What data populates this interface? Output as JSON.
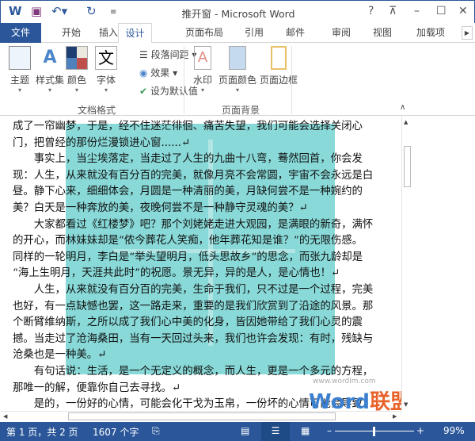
{
  "title_bar": {
    "title": "推开窗 - Microsoft Word",
    "help": "?",
    "icons": [
      "word-icon",
      "save-icon",
      "undo-icon",
      "redo-icon",
      "customize-icon"
    ]
  },
  "tabs": [
    "文件",
    "开始",
    "插入",
    "设计",
    "页面布局",
    "引用",
    "邮件",
    "审阅",
    "视图",
    "加载项"
  ],
  "ribbon": {
    "doc_format": {
      "label": "文档格式",
      "buttons": [
        "主题",
        "样式集",
        "颜色",
        "字体"
      ],
      "small": [
        "段落间距",
        "效果",
        "设为默认值"
      ]
    },
    "page_bg": {
      "label": "页面背景",
      "buttons": [
        "水印",
        "页面颜色",
        "页面边框"
      ]
    }
  },
  "document": {
    "lines": [
      "成了一帘幽梦，于是，经不住迷茫徘徊、痛苦失望，我们可能会选择关闭心",
      "门，把曾经的那份烂漫锁进心窗......↵",
      "　　事实上，当尘埃落定，当走过了人生的九曲十八弯，蓦然回首，你会发",
      "现：人生，从来就没有百分百的完美，就像月亮不会常圆，宇宙不会永远是白",
      "昼。静下心来，细细体会，月圆是一种清丽的美，月缺何尝不是一种婉约的",
      "美？白天是一种奔放的美，夜晚何尝不是一种静守灵魂的美？↵",
      "　　大家都看过《红楼梦》吧？那个刘姥姥走进大观园，是满眼的新奇，满怀",
      "的开心，而林妹妹却是“侬今葬花人笑痴，他年葬花知是谁？”的无限伤感。",
      "同样的一轮明月，李白是“举头望明月，低头思故乡”的思念，而张九龄却是",
      "“海上生明月，天涯共此时”的祝愿。景无异，异的是人，是心情也！↵",
      "　　人生，从来就没有百分百的完美，生命于我们，只不过是一个过程，完美",
      "也好，有一点缺憾也罢，这一路走来，重要的是我们欣赏到了沿途的风景。那",
      "个断臂维纳斯，之所以成了我们心中美的化身，皆因她带给了我们心灵的震",
      "撼。当走过了沧海桑田，当有一天回过头来，我们也许会发现：有时，残缺与",
      "沧桑也是一种美。↵",
      "　　有句话说：生活，是一个无定义的概念，而人生，更是一个多元的方程，",
      "那唯一的解，便靠你自己去寻找。↵",
      "　　是的，一份好的心情，可能会化干戈为玉帛，一份坏的心情可能会导致"
    ],
    "logo": "Word联盟",
    "logo_url": "www.wordlm.com"
  },
  "status": {
    "page": "第 1 页，共 2 页",
    "words": "1607 个字",
    "zoom": "99%"
  },
  "colors": {
    "accent": "#2b579a",
    "picture": "#88d9d8"
  }
}
